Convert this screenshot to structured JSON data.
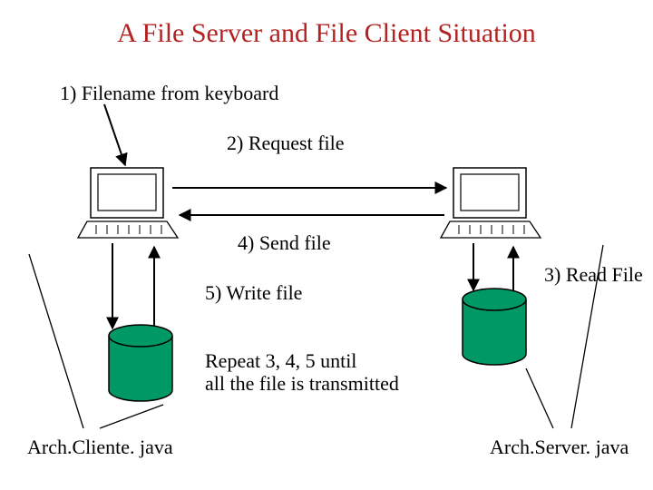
{
  "title": "A File Server and File Client Situation",
  "steps": {
    "s1": "1) Filename from keyboard",
    "s2": "2) Request file",
    "s3": "3) Read File",
    "s4": "4) Send file",
    "s5": "5) Write file",
    "repeat": "Repeat 3, 4, 5 until\nall the file is transmitted"
  },
  "labels": {
    "client": "Arch.Cliente. java",
    "server": "Arch.Server. java"
  },
  "colors": {
    "title": "#b22222",
    "diskFill": "#009966",
    "diskStroke": "#000000"
  }
}
